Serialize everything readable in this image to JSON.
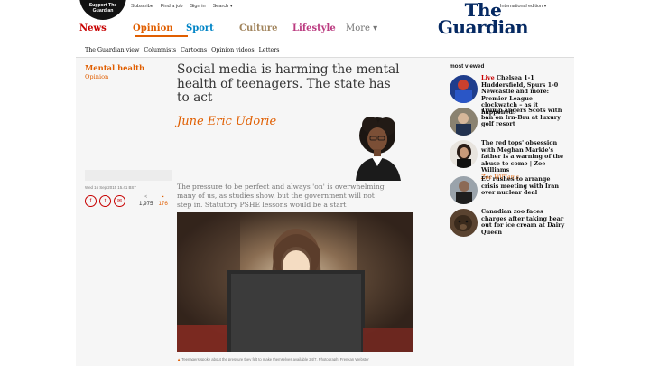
{
  "header": {
    "support_label": "Support The Guardian",
    "top_links": [
      "Subscribe",
      "Find a job",
      "Sign in",
      "Search"
    ],
    "edition": "International edition",
    "logo_line1": "The",
    "logo_line2": "Guardian"
  },
  "pillars": [
    {
      "label": "News",
      "color": "#c70000"
    },
    {
      "label": "Opinion",
      "color": "#e05e00"
    },
    {
      "label": "Sport",
      "color": "#0084c6"
    },
    {
      "label": "Culture",
      "color": "#a1845c"
    },
    {
      "label": "Lifestyle",
      "color": "#bb3b80"
    },
    {
      "label": "More",
      "color": "#767676"
    }
  ],
  "subnav": [
    "The Guardian view",
    "Columnists",
    "Cartoons",
    "Opinion videos",
    "Letters"
  ],
  "article": {
    "section": "Mental health",
    "kicker": "Opinion",
    "headline": "Social media is harming the mental health of teenagers. The state has to act",
    "byline": "June Eric Udorie",
    "standfirst": "The pressure to be perfect and always 'on' is overwhelming many of us, as studies show, but the government will not step in. Statutory PSHE lessons would be a start",
    "date": "Wed 16 Sep 2015 15.41 BST",
    "shares": "1,975",
    "comments": "176",
    "caption": "Teenagers spoke about the pressure they felt to make themselves available 24/7. Photograph: Frenkan Webster"
  },
  "most_viewed": {
    "title": "most viewed",
    "items": [
      {
        "live": "Live",
        "text": "Chelsea 1-1 Huddersfield, Spurs 1-0 Newcastle and more: Premier League clockwatch – as it happened",
        "author": ""
      },
      {
        "live": "",
        "text": "Trump angers Scots with ban on Irn-Bru at luxury golf resort",
        "author": ""
      },
      {
        "live": "",
        "text": "The red tops' obsession with Meghan Markle's father is a warning of the abuse to come | Zoe Williams",
        "author": "Zoe Williams"
      },
      {
        "live": "",
        "text": "EU rushes to arrange crisis meeting with Iran over nuclear deal",
        "author": ""
      },
      {
        "live": "",
        "text": "Canadian zoo faces charges after taking bear out for ice cream at Dairy Queen",
        "author": ""
      }
    ]
  },
  "colors": {
    "brand": "#052962",
    "opinion": "#e05e00",
    "news": "#c70000"
  }
}
